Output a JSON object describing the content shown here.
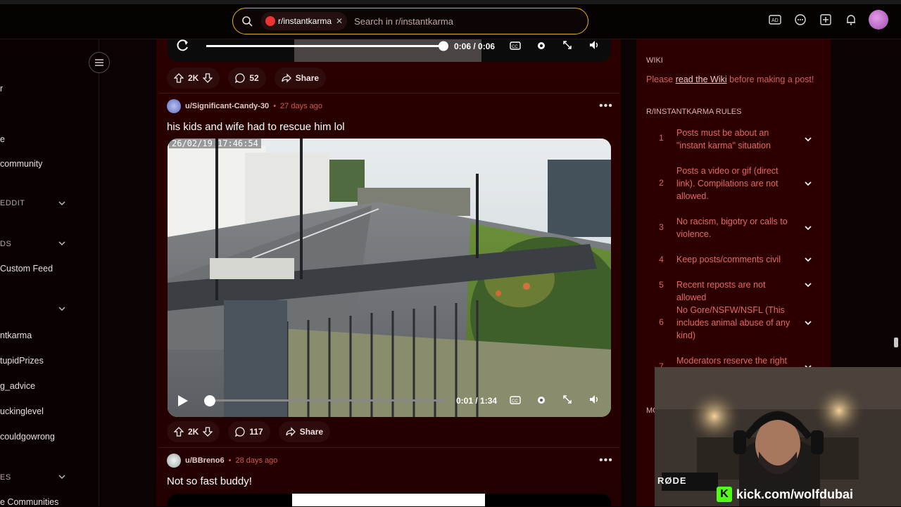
{
  "search": {
    "community_chip": "r/instantkarma",
    "placeholder": "Search in r/instantkarma"
  },
  "left_nav": {
    "items": [
      {
        "label": "r"
      },
      {
        "label": "e"
      },
      {
        "label": "community"
      },
      {
        "label": "EDDIT"
      },
      {
        "label": "DS"
      },
      {
        "label": "Custom Feed"
      },
      {
        "label": "ntkarma"
      },
      {
        "label": "tupidPrizes"
      },
      {
        "label": "g_advice"
      },
      {
        "label": "uckinglevel"
      },
      {
        "label": "couldgowrong"
      },
      {
        "label": "ES"
      },
      {
        "label": "e Communities"
      }
    ]
  },
  "prev_post": {
    "video_time": "0:06 / 0:06",
    "progress": 1.0,
    "votes": "2K",
    "comments": "52",
    "share": "Share"
  },
  "post1": {
    "user": "u/Significant-Candy-30",
    "time": "27 days ago",
    "title": "his kids and wife had to rescue him lol",
    "overlay_timestamp": "26/02/19 17:46:54",
    "video_time": "0:01 / 1:34",
    "progress": 0.0,
    "votes": "2K",
    "comments": "117",
    "share": "Share"
  },
  "post2": {
    "user": "u/BBreno6",
    "time": "28 days ago",
    "title": "Not so fast buddy!"
  },
  "sidebar": {
    "wiki_heading": "WIKI",
    "wiki_pre": "Please ",
    "wiki_link": "read the Wiki",
    "wiki_post": " before making a post!",
    "rules_heading": "R/INSTANTKARMA RULES",
    "rules": [
      {
        "num": "1",
        "text": "Posts must be about an \"instant karma\" situation"
      },
      {
        "num": "2",
        "text": "Posts a video or gif (direct link). Compilations are not allowed."
      },
      {
        "num": "3",
        "text": "No racism, bigotry or calls to violence."
      },
      {
        "num": "4",
        "text": "Keep posts/comments civil"
      },
      {
        "num": "5",
        "text": "Recent reposts are not allowed"
      },
      {
        "num": "6",
        "text": "No Gore/NSFW/NSFL (This includes animal abuse of any kind)"
      },
      {
        "num": "7",
        "text": "Moderators reserve the right"
      }
    ],
    "mods_heading_partial": "MC"
  },
  "webcam": {
    "kick_handle": "kick.com/wolfdubai",
    "mic_brand": "RØDE"
  },
  "colors": {
    "accent_search": "#e0b318",
    "feed_bg": "#2a0000",
    "time_red": "#cf5d4d",
    "rule_red": "#e26a66"
  }
}
